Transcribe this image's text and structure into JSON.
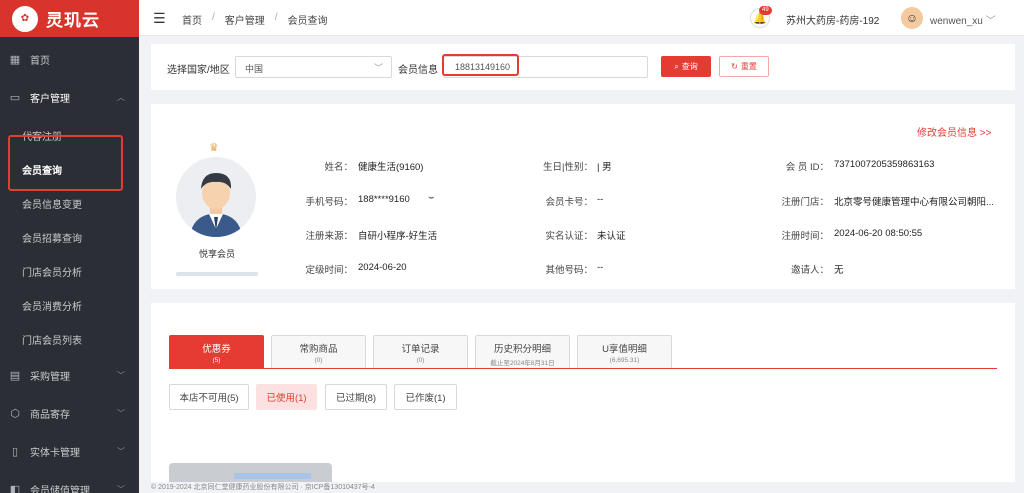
{
  "app": {
    "logo_text": "灵玑云",
    "logo_badge": "同仁堂"
  },
  "sidebar": {
    "items": [
      {
        "label": "首页",
        "icon": "grid-icon"
      },
      {
        "label": "客户管理",
        "icon": "customer-icon"
      },
      {
        "label": "采购管理",
        "icon": "purchase-icon"
      },
      {
        "label": "商品寄存",
        "icon": "box-icon"
      },
      {
        "label": "实体卡管理",
        "icon": "card-icon"
      },
      {
        "label": "会员储值管理",
        "icon": "wallet-icon"
      }
    ],
    "sub_items": [
      "代客注册",
      "会员查询",
      "会员信息变更",
      "会员招募查询",
      "门店会员分析",
      "会员消费分析",
      "门店会员列表"
    ]
  },
  "header": {
    "breadcrumbs": [
      "首页",
      "客户管理",
      "会员查询"
    ],
    "notification_count": "49",
    "store": "苏州大药房-药房-192",
    "username": "wenwen_xu"
  },
  "search": {
    "country_label": "选择国家/地区",
    "country_value": "中国",
    "member_label": "会员信息",
    "member_value": "18813149160",
    "query_label": "查询",
    "reset_label": "重置"
  },
  "profile": {
    "edit_link": "修改会员信息 >>",
    "level": "悦享会员",
    "fields": {
      "name_label": "姓名：",
      "name_value": "健康生活(9160)",
      "birthday_label": "生日|性别：",
      "birthday_value": "| 男",
      "member_id_label": "会 员 ID：",
      "member_id_value": "7371007205359863163",
      "phone_label": "手机号码：",
      "phone_value": "188****9160",
      "card_label": "会员卡号：",
      "card_value": "--",
      "reg_store_label": "注册门店：",
      "reg_store_value": "北京零号健康管理中心有限公司朝阳...",
      "source_label": "注册来源：",
      "source_value": "自研小程序-好生活",
      "realname_label": "实名认证：",
      "realname_value": "未认证",
      "reg_time_label": "注册时间：",
      "reg_time_value": "2024-06-20 08:50:55",
      "grade_time_label": "定级时间：",
      "grade_time_value": "2024-06-20",
      "other_phone_label": "其他号码：",
      "other_phone_value": "--",
      "inviter_label": "邀请人：",
      "inviter_value": "无"
    }
  },
  "tabs": [
    {
      "label": "优惠券",
      "sub": "(5)"
    },
    {
      "label": "常购商品",
      "sub": "(0)"
    },
    {
      "label": "订单记录",
      "sub": "(0)"
    },
    {
      "label": "历史积分明细",
      "sub": "截止至2024年8月31日"
    },
    {
      "label": "U享值明细",
      "sub": "(6,695.31)"
    }
  ],
  "filters": [
    "本店不可用(5)",
    "已使用(1)",
    "已过期(8)",
    "已作废(1)"
  ],
  "footer": "© 2019-2024 北京同仁堂健康药业股份有限公司 · 京ICP备13010437号-4",
  "colors": {
    "accent": "#e43b33",
    "sidebar": "#2b2f35"
  }
}
